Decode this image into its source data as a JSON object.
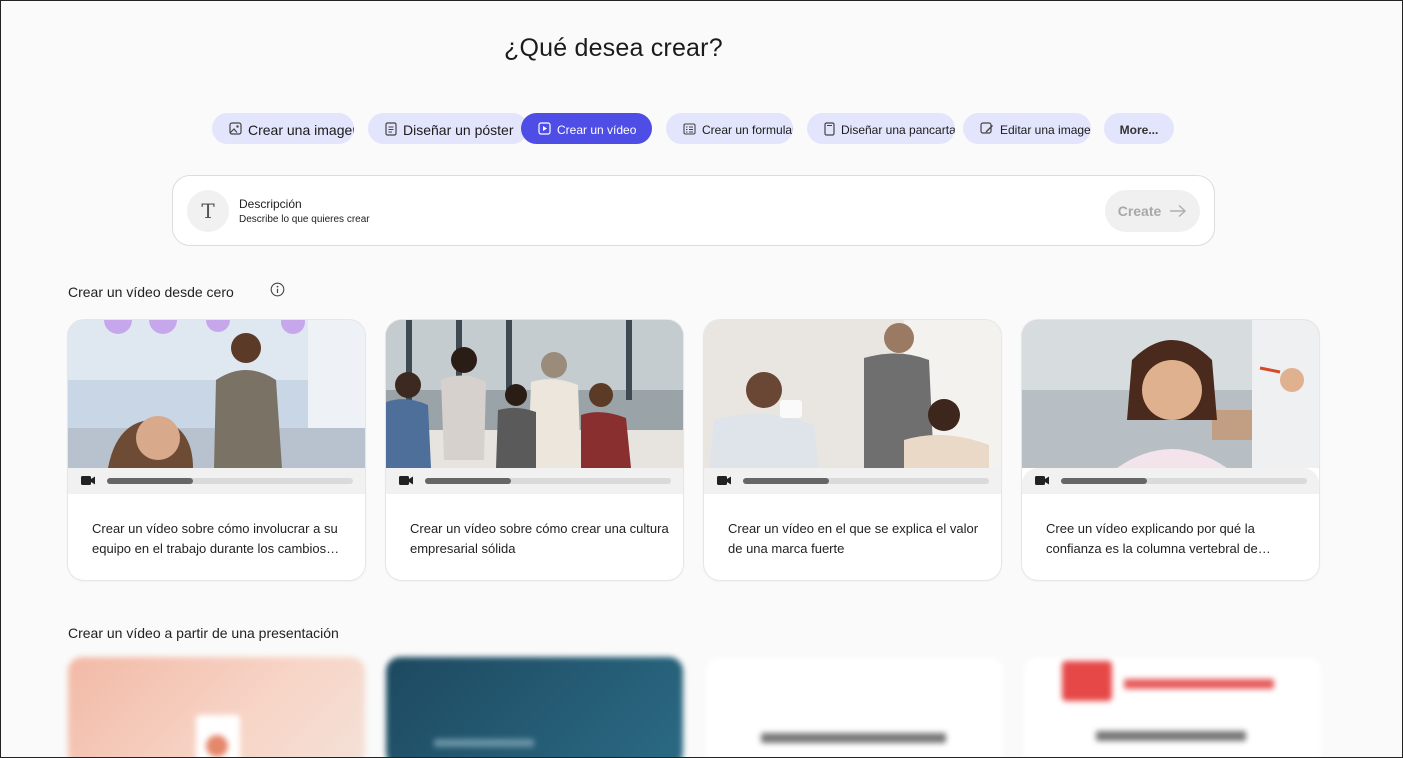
{
  "heading": "¿Qué desea crear?",
  "tabs": [
    {
      "label": "Crear una imagen",
      "icon": "image-icon"
    },
    {
      "label": "Diseñar un póster",
      "icon": "poster-icon"
    },
    {
      "label": "Crear un vídeo",
      "icon": "video-icon",
      "active": true
    },
    {
      "label": "Crear un formulario",
      "icon": "form-icon"
    },
    {
      "label": "Diseñar una pancarta",
      "icon": "banner-icon"
    },
    {
      "label": "Editar una imagen",
      "icon": "edit-image-icon"
    },
    {
      "label": "More...",
      "icon": ""
    }
  ],
  "prompt": {
    "icon": "text-icon",
    "icon_glyph": "T",
    "title": "Descripción",
    "placeholder": "Describe lo que quieres crear",
    "create_label": "Create"
  },
  "section_scratch": {
    "title": "Crear un vídeo desde cero",
    "info_icon": "info-icon"
  },
  "video_cards": [
    {
      "text": "Crear un vídeo sobre cómo involucrar a su equipo en el trabajo durante los cambios direccionales",
      "progress": 0.35
    },
    {
      "text": "Crear un vídeo sobre cómo crear una cultura empresarial sólida",
      "progress": 0.35
    },
    {
      "text": "Crear un vídeo en el que se explica el valor de una marca fuerte",
      "progress": 0.35
    },
    {
      "text": "Cree un vídeo explicando por qué la confianza es la columna vertebral de cualquier alto rendimiento...",
      "progress": 0.35
    }
  ],
  "section_presentation": {
    "title": "Crear un vídeo a partir de una presentación"
  },
  "colors": {
    "accent": "#4e4ee6",
    "pill": "#e2e5fb",
    "background": "#fafafa"
  }
}
